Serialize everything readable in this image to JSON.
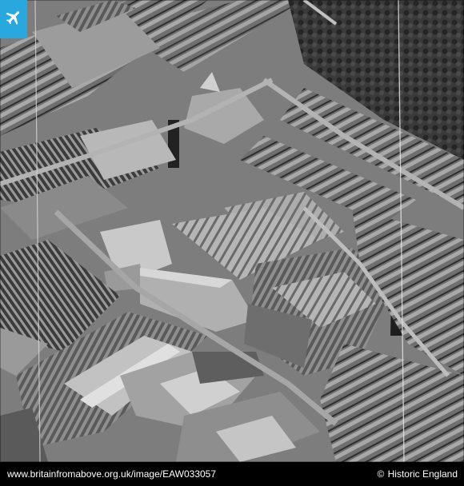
{
  "photo": {
    "description_icon": "airplane-icon",
    "badge_color": "#29a8e0"
  },
  "caption": {
    "url_text": "www.britainfromabove.org.uk/image/EAW033057",
    "credit_symbol": "©",
    "credit_text": "Historic England"
  }
}
